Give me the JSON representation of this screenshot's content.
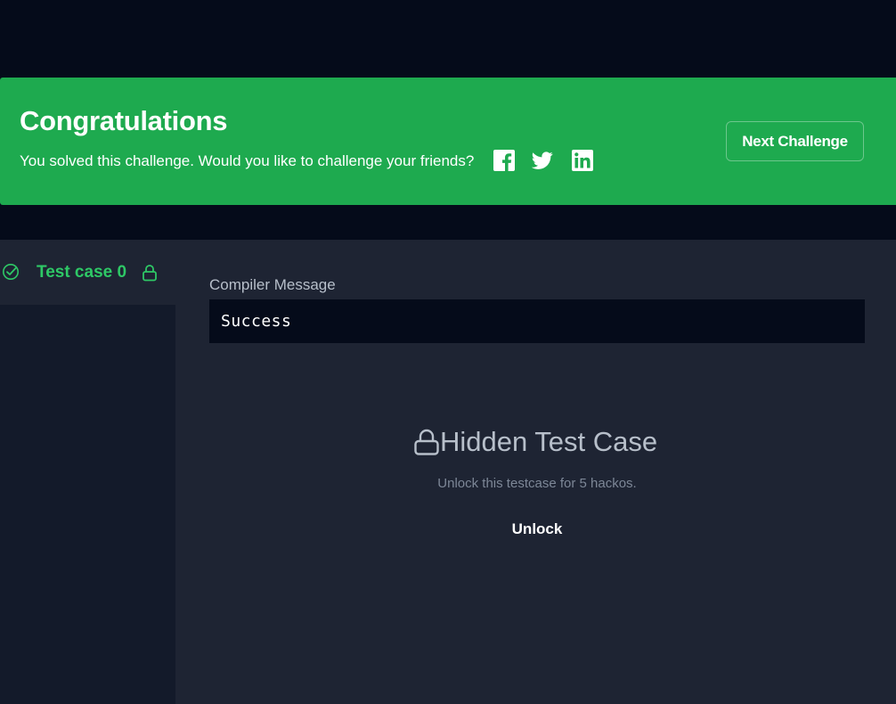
{
  "banner": {
    "title": "Congratulations",
    "subtitle": "You solved this challenge. Would you like to challenge your friends?",
    "social_icons": [
      "facebook-icon",
      "twitter-icon",
      "linkedin-icon"
    ],
    "next_button_label": "Next Challenge",
    "background_color": "#1eaa4f"
  },
  "sidebar": {
    "tabs": [
      {
        "label": "Test case 0",
        "status": "passed",
        "locked": true
      }
    ]
  },
  "main": {
    "compiler_label": "Compiler Message",
    "compiler_output": "Success",
    "hidden": {
      "title": "Hidden Test Case",
      "subtitle": "Unlock this testcase for 5 hackos.",
      "unlock_label": "Unlock"
    }
  },
  "colors": {
    "accent_green": "#2ec866",
    "page_background": "#050b1a",
    "panel_background": "#1e2433"
  }
}
